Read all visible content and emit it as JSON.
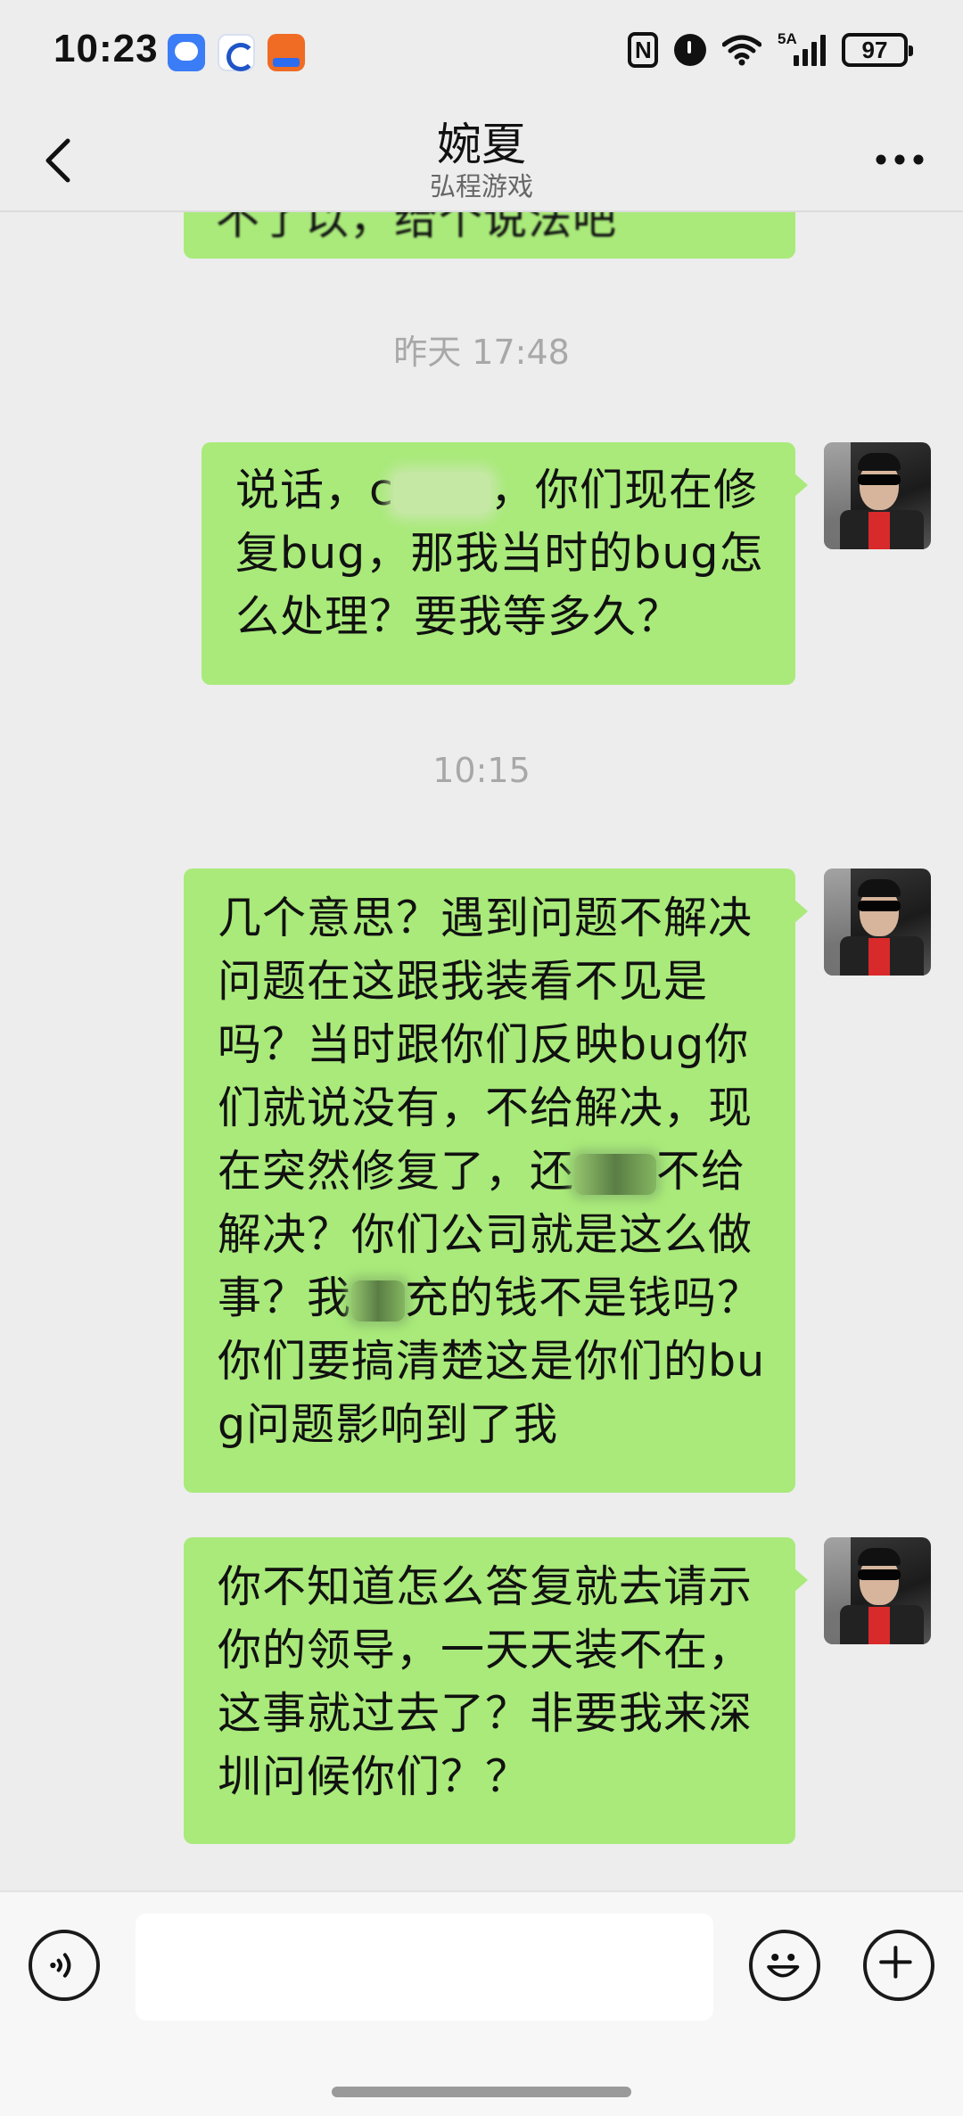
{
  "status_bar": {
    "time": "10:23",
    "network_label": "5A",
    "battery": "97"
  },
  "header": {
    "title": "婉夏",
    "subtitle": "弘程游戏"
  },
  "messages": {
    "partial_top": "不了以，给个说法吧",
    "ts1": "昨天 17:48",
    "m1_a": "说话，c",
    "m1_b": "，你们现在修复bug，那我当时的bug怎么处理？要我等多久？",
    "ts2": "10:15",
    "m2_a": "几个意思？遇到问题不解决问题在这跟我装看不见是吗？当时跟你们反映bug你们就说没有，不给解决，现在突然修复了，还",
    "m2_b": "不给解决？你们公司就是这么做事？我",
    "m2_c": "充的钱不是钱吗？你们要搞清楚这是你们的bug问题影响到了我",
    "m3": "你不知道怎么答复就去请示你的领导，一天天装不在，这事就过去了？非要我来深圳问候你们？？"
  },
  "colors": {
    "bubble": "#a9ea7a",
    "background": "#ededed"
  },
  "icons": {
    "back": "back-arrow-icon",
    "more": "more-dots-icon",
    "voice": "voice-icon",
    "emoji": "emoji-icon",
    "plus": "plus-icon"
  }
}
